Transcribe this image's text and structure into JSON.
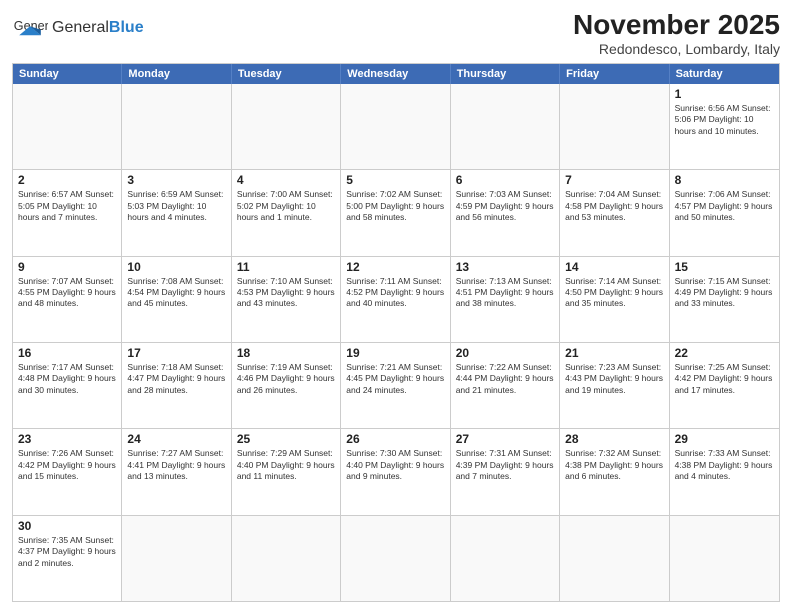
{
  "header": {
    "logo_general": "General",
    "logo_blue": "Blue",
    "title": "November 2025",
    "subtitle": "Redondesco, Lombardy, Italy"
  },
  "days_of_week": [
    "Sunday",
    "Monday",
    "Tuesday",
    "Wednesday",
    "Thursday",
    "Friday",
    "Saturday"
  ],
  "weeks": [
    [
      {
        "day": "",
        "info": ""
      },
      {
        "day": "",
        "info": ""
      },
      {
        "day": "",
        "info": ""
      },
      {
        "day": "",
        "info": ""
      },
      {
        "day": "",
        "info": ""
      },
      {
        "day": "",
        "info": ""
      },
      {
        "day": "1",
        "info": "Sunrise: 6:56 AM\nSunset: 5:06 PM\nDaylight: 10 hours and 10 minutes."
      }
    ],
    [
      {
        "day": "2",
        "info": "Sunrise: 6:57 AM\nSunset: 5:05 PM\nDaylight: 10 hours and 7 minutes."
      },
      {
        "day": "3",
        "info": "Sunrise: 6:59 AM\nSunset: 5:03 PM\nDaylight: 10 hours and 4 minutes."
      },
      {
        "day": "4",
        "info": "Sunrise: 7:00 AM\nSunset: 5:02 PM\nDaylight: 10 hours and 1 minute."
      },
      {
        "day": "5",
        "info": "Sunrise: 7:02 AM\nSunset: 5:00 PM\nDaylight: 9 hours and 58 minutes."
      },
      {
        "day": "6",
        "info": "Sunrise: 7:03 AM\nSunset: 4:59 PM\nDaylight: 9 hours and 56 minutes."
      },
      {
        "day": "7",
        "info": "Sunrise: 7:04 AM\nSunset: 4:58 PM\nDaylight: 9 hours and 53 minutes."
      },
      {
        "day": "8",
        "info": "Sunrise: 7:06 AM\nSunset: 4:57 PM\nDaylight: 9 hours and 50 minutes."
      }
    ],
    [
      {
        "day": "9",
        "info": "Sunrise: 7:07 AM\nSunset: 4:55 PM\nDaylight: 9 hours and 48 minutes."
      },
      {
        "day": "10",
        "info": "Sunrise: 7:08 AM\nSunset: 4:54 PM\nDaylight: 9 hours and 45 minutes."
      },
      {
        "day": "11",
        "info": "Sunrise: 7:10 AM\nSunset: 4:53 PM\nDaylight: 9 hours and 43 minutes."
      },
      {
        "day": "12",
        "info": "Sunrise: 7:11 AM\nSunset: 4:52 PM\nDaylight: 9 hours and 40 minutes."
      },
      {
        "day": "13",
        "info": "Sunrise: 7:13 AM\nSunset: 4:51 PM\nDaylight: 9 hours and 38 minutes."
      },
      {
        "day": "14",
        "info": "Sunrise: 7:14 AM\nSunset: 4:50 PM\nDaylight: 9 hours and 35 minutes."
      },
      {
        "day": "15",
        "info": "Sunrise: 7:15 AM\nSunset: 4:49 PM\nDaylight: 9 hours and 33 minutes."
      }
    ],
    [
      {
        "day": "16",
        "info": "Sunrise: 7:17 AM\nSunset: 4:48 PM\nDaylight: 9 hours and 30 minutes."
      },
      {
        "day": "17",
        "info": "Sunrise: 7:18 AM\nSunset: 4:47 PM\nDaylight: 9 hours and 28 minutes."
      },
      {
        "day": "18",
        "info": "Sunrise: 7:19 AM\nSunset: 4:46 PM\nDaylight: 9 hours and 26 minutes."
      },
      {
        "day": "19",
        "info": "Sunrise: 7:21 AM\nSunset: 4:45 PM\nDaylight: 9 hours and 24 minutes."
      },
      {
        "day": "20",
        "info": "Sunrise: 7:22 AM\nSunset: 4:44 PM\nDaylight: 9 hours and 21 minutes."
      },
      {
        "day": "21",
        "info": "Sunrise: 7:23 AM\nSunset: 4:43 PM\nDaylight: 9 hours and 19 minutes."
      },
      {
        "day": "22",
        "info": "Sunrise: 7:25 AM\nSunset: 4:42 PM\nDaylight: 9 hours and 17 minutes."
      }
    ],
    [
      {
        "day": "23",
        "info": "Sunrise: 7:26 AM\nSunset: 4:42 PM\nDaylight: 9 hours and 15 minutes."
      },
      {
        "day": "24",
        "info": "Sunrise: 7:27 AM\nSunset: 4:41 PM\nDaylight: 9 hours and 13 minutes."
      },
      {
        "day": "25",
        "info": "Sunrise: 7:29 AM\nSunset: 4:40 PM\nDaylight: 9 hours and 11 minutes."
      },
      {
        "day": "26",
        "info": "Sunrise: 7:30 AM\nSunset: 4:40 PM\nDaylight: 9 hours and 9 minutes."
      },
      {
        "day": "27",
        "info": "Sunrise: 7:31 AM\nSunset: 4:39 PM\nDaylight: 9 hours and 7 minutes."
      },
      {
        "day": "28",
        "info": "Sunrise: 7:32 AM\nSunset: 4:38 PM\nDaylight: 9 hours and 6 minutes."
      },
      {
        "day": "29",
        "info": "Sunrise: 7:33 AM\nSunset: 4:38 PM\nDaylight: 9 hours and 4 minutes."
      }
    ],
    [
      {
        "day": "30",
        "info": "Sunrise: 7:35 AM\nSunset: 4:37 PM\nDaylight: 9 hours and 2 minutes."
      },
      {
        "day": "",
        "info": ""
      },
      {
        "day": "",
        "info": ""
      },
      {
        "day": "",
        "info": ""
      },
      {
        "day": "",
        "info": ""
      },
      {
        "day": "",
        "info": ""
      },
      {
        "day": "",
        "info": ""
      }
    ]
  ]
}
